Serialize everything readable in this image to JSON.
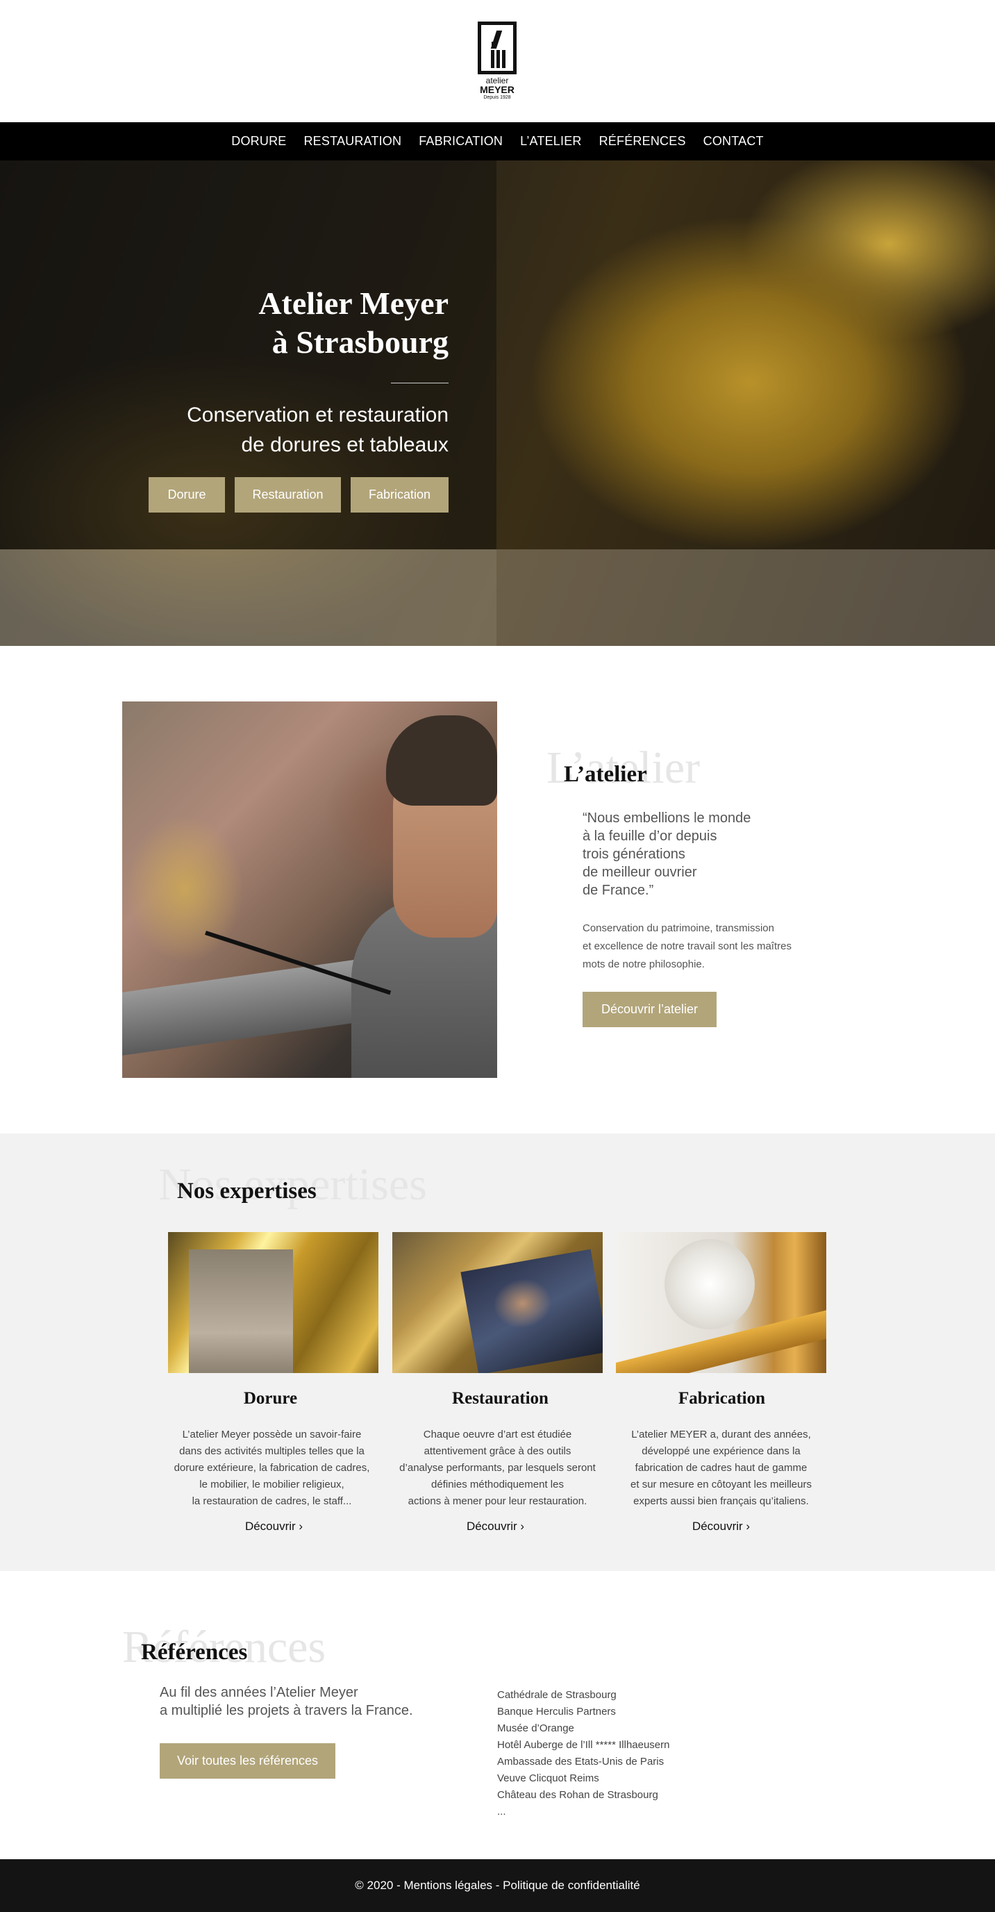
{
  "logo": {
    "line1": "atelier",
    "line2": "MEYER",
    "line3": "Depuis 1928"
  },
  "nav": {
    "items": [
      "DORURE",
      "RESTAURATION",
      "FABRICATION",
      "L’ATELIER",
      "RÉFÉRENCES",
      "CONTACT"
    ]
  },
  "hero": {
    "title_line1": "Atelier Meyer",
    "title_line2": "à Strasbourg",
    "subtitle_line1": "Conservation et restauration",
    "subtitle_line2": "de dorures et tableaux",
    "buttons": [
      "Dorure",
      "Restauration",
      "Fabrication"
    ]
  },
  "atelier": {
    "ghost_title": "L’atelier",
    "title": "L’atelier",
    "quote_lines": [
      "“Nous embellions le monde",
      "à la feuille d’or depuis",
      "trois générations",
      "de meilleur ouvrier",
      "de France.”"
    ],
    "desc_lines": [
      "Conservation du patrimoine, transmission",
      "et excellence de notre travail sont les maîtres",
      "mots de notre philosophie."
    ],
    "button": "Découvrir l’atelier"
  },
  "expertises": {
    "ghost_title": "Nos expertises",
    "title": "Nos expertises",
    "cards": [
      {
        "title": "Dorure",
        "lines": [
          "L’atelier Meyer possède un savoir-faire",
          "dans des activités multiples telles que la",
          "dorure extérieure, la fabrication de cadres,",
          "le mobilier, le mobilier religieux,",
          "la restauration de cadres, le staff..."
        ],
        "link": "Découvrir ›"
      },
      {
        "title": "Restauration",
        "lines": [
          "Chaque oeuvre d’art est étudiée",
          "attentivement grâce à des outils",
          "d’analyse performants, par lesquels seront",
          "définies méthodiquement les",
          "actions à mener pour leur restauration."
        ],
        "link": "Découvrir ›"
      },
      {
        "title": "Fabrication",
        "lines": [
          "L’atelier MEYER a, durant des années,",
          "développé une expérience dans la",
          "fabrication de cadres haut de gamme",
          "et sur mesure en côtoyant les meilleurs",
          "experts aussi bien français qu’italiens."
        ],
        "link": "Découvrir ›"
      }
    ]
  },
  "references": {
    "ghost_title": "Références",
    "title": "Références",
    "intro_lines": [
      "Au fil des années  l’Atelier Meyer",
      "a multiplié les projets  à travers la France."
    ],
    "button": "Voir toutes les références",
    "list": [
      "Cathédrale de Strasbourg",
      "Banque Herculis Partners",
      "Musée d’Orange",
      "Hotêl Auberge de l’Ill ***** Illhaeusern",
      "Ambassade des Etats-Unis de Paris",
      "Veuve Clicquot Reims",
      "Château des Rohan de Strasbourg",
      "..."
    ]
  },
  "footer": {
    "text": "© 2020 - Mentions légales - Politique de confidentialité"
  },
  "colors": {
    "accent": "#b2a57a",
    "nav_bg": "#000000",
    "footer_bg": "#141414",
    "section_gray": "#f2f2f2"
  }
}
